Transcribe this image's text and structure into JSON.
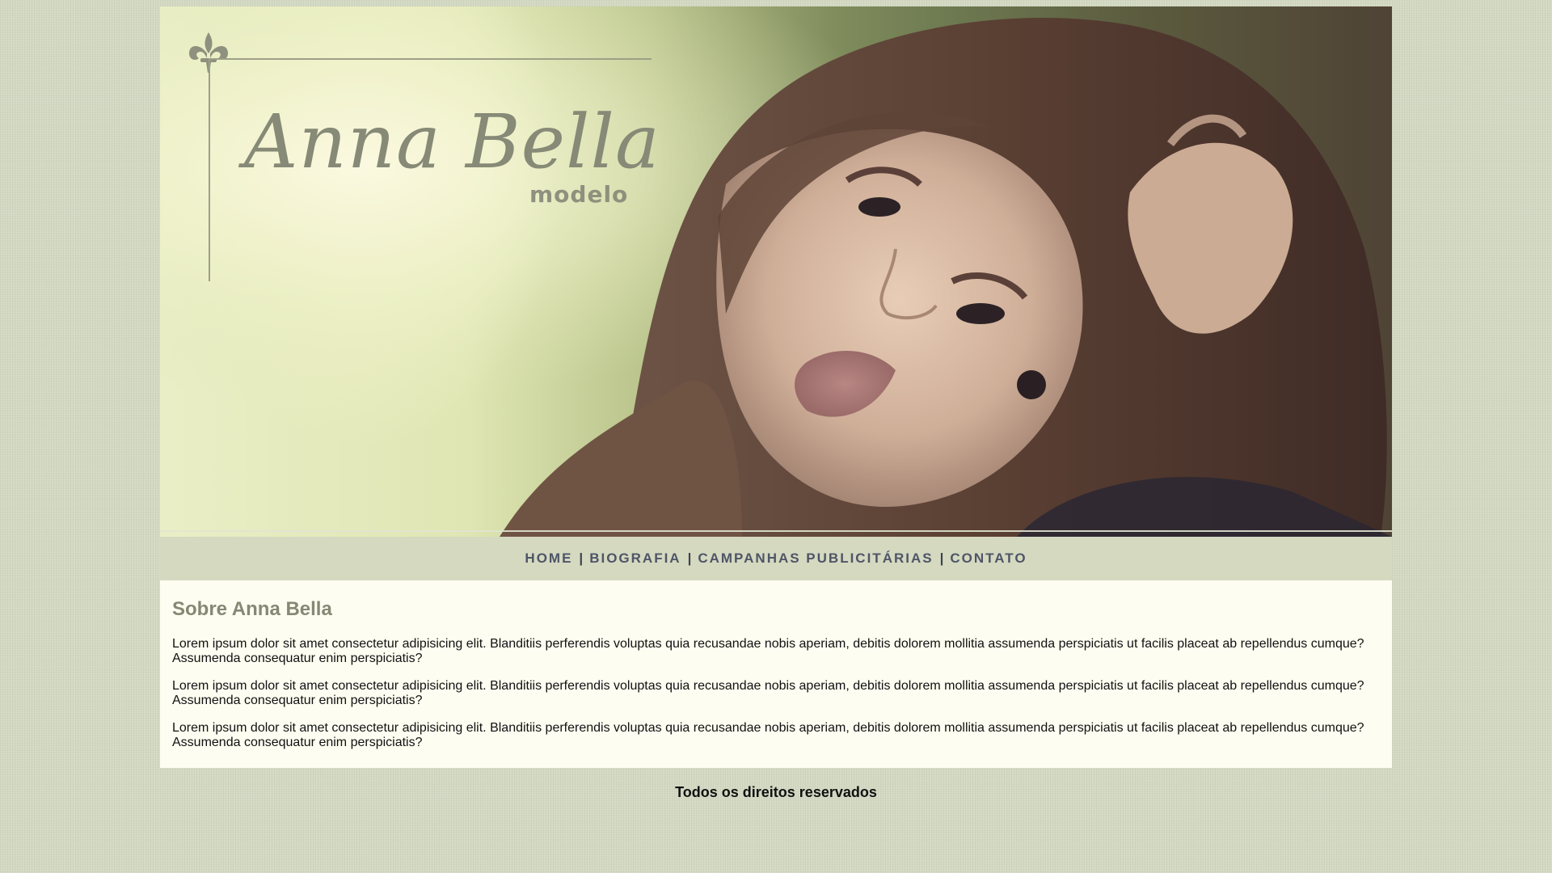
{
  "banner": {
    "logo_name": "Anna Bella",
    "logo_subtitle": "modelo",
    "photo_alt": "Portrait of a woman with long brown hair, hand in hair"
  },
  "nav": {
    "items": [
      {
        "label": "HOME"
      },
      {
        "label": "BIOGRAFIA"
      },
      {
        "label": "CAMPANHAS PUBLICITÁRIAS"
      },
      {
        "label": "CONTATO"
      }
    ],
    "separator": "|"
  },
  "main": {
    "title": "Sobre Anna Bella",
    "paragraphs": [
      "Lorem ipsum dolor sit amet consectetur adipisicing elit. Blanditiis perferendis voluptas quia recusandae nobis aperiam, debitis dolorem mollitia assumenda perspiciatis ut facilis placeat ab repellendus cumque? Assumenda consequatur enim perspiciatis?",
      "Lorem ipsum dolor sit amet consectetur adipisicing elit. Blanditiis perferendis voluptas quia recusandae nobis aperiam, debitis dolorem mollitia assumenda perspiciatis ut facilis placeat ab repellendus cumque? Assumenda consequatur enim perspiciatis?",
      "Lorem ipsum dolor sit amet consectetur adipisicing elit. Blanditiis perferendis voluptas quia recusandae nobis aperiam, debitis dolorem mollitia assumenda perspiciatis ut facilis placeat ab repellendus cumque? Assumenda consequatur enim perspiciatis?"
    ]
  },
  "footer": {
    "text": "Todos os direitos reservados"
  },
  "colors": {
    "page_background": "#d3d9c2",
    "nav_background": "#d4d9c0",
    "content_background": "#fdfdf1",
    "title_color": "#858873",
    "nav_link_color": "#4f5567"
  }
}
